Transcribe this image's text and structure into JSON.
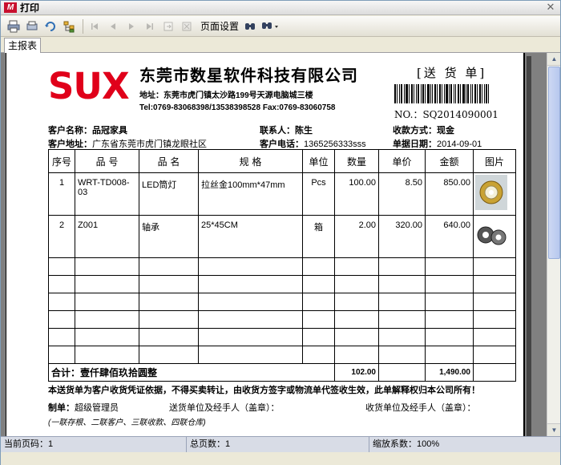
{
  "window": {
    "title": "打印",
    "app_icon_text": "M"
  },
  "toolbar": {
    "page_setup_label": "页面设置",
    "icons": [
      "print-icon",
      "print-preview-icon",
      "refresh-icon",
      "tree-icon",
      "first-page-icon",
      "prev-page-icon",
      "next-page-icon",
      "last-page-icon",
      "export-icon",
      "close-doc-icon",
      "find-icon",
      "zoom-icon"
    ]
  },
  "tabs": [
    {
      "label": "主报表"
    }
  ],
  "document": {
    "logo": "SUX",
    "company": "东莞市数星软件科技有限公司",
    "doc_title": "[送 货 单]",
    "address": "地址：东莞市虎门镇太沙路199号天源电脑城三楼",
    "tel": "Tel:0769-83068398/13538398528  Fax:0769-83060758",
    "doc_no": "NO.：SQ2014090001",
    "customer_name_label": "客户名称：",
    "customer_name": "品冠家具",
    "contact_label": "联系人：",
    "contact": "陈生",
    "payment_label": "收款方式：",
    "payment": "现金",
    "customer_addr_label": "客户地址：",
    "customer_addr": "广东省东莞市虎门镇龙眼社区",
    "customer_phone_label": "客户电话：",
    "customer_phone": "1365256333sss",
    "date_label": "单据日期：",
    "date": "2014-09-01",
    "columns": [
      "序号",
      "品 号",
      "品 名",
      "规 格",
      "单位",
      "数量",
      "单价",
      "金额",
      "图片"
    ],
    "rows": [
      {
        "no": "1",
        "code": "WRT-TD008-03",
        "name": "LED筒灯",
        "spec": "拉丝金100mm*47mm",
        "unit": "Pcs",
        "qty": "100.00",
        "price": "8.50",
        "amount": "850.00",
        "image": "led-downlight"
      },
      {
        "no": "2",
        "code": "Z001",
        "name": "轴承",
        "spec": "25*45CM",
        "unit": "箱",
        "qty": "2.00",
        "price": "320.00",
        "amount": "640.00",
        "image": "bearing"
      }
    ],
    "total_label": "合计：壹仟肆佰玖拾圆整",
    "total_qty": "102.00",
    "total_amount": "1,490.00",
    "note": "本送货单为客户收货凭证依据，不得买卖转让，由收货方签字或物流单代签收生效，此单解释权归本公司所有！",
    "maker_label": "制单：",
    "maker": "超级管理员",
    "sender_label": "送货单位及经手人（盖章）：",
    "receiver_label": "收货单位及经手人（盖章）：",
    "copies": "(一联存根、二联客户、三联收款、四联仓库)"
  },
  "status": {
    "current_page": "当前页码：1",
    "total_pages": "总页数：1",
    "zoom": "缩放系数：100%"
  }
}
